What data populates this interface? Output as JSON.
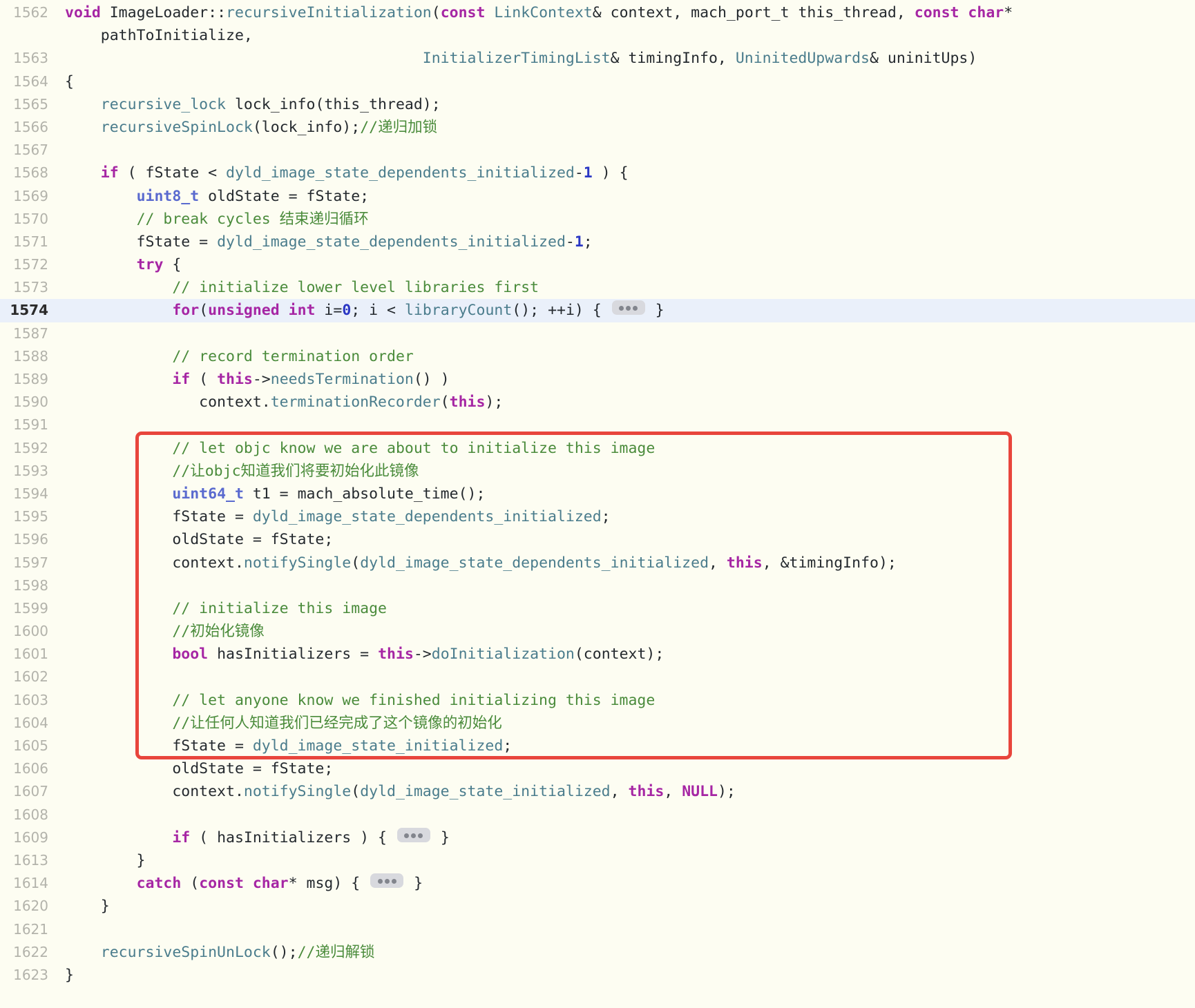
{
  "viewer": {
    "type": "source-code-viewer",
    "language": "C++",
    "background_color": "#fdfdf2",
    "highlight_color": "#eaf0fa",
    "annotation_color": "#e8453c",
    "gutter_color": "#b3b3ab"
  },
  "annotation": {
    "shape": "rectangle",
    "color": "#e8453c",
    "covers_lines": "1592-1607"
  },
  "collapsed_marker": {
    "label": "...",
    "tooltip": "expand collapsed code"
  },
  "lines": [
    {
      "number": "1562",
      "highlight": false,
      "tokens": [
        {
          "t": "void",
          "c": "kw"
        },
        {
          "t": " ",
          "c": "plain"
        },
        {
          "t": "ImageLoader",
          "c": "plain"
        },
        {
          "t": "::",
          "c": "plain"
        },
        {
          "t": "recursiveInitialization",
          "c": "fn"
        },
        {
          "t": "(",
          "c": "plain"
        },
        {
          "t": "const",
          "c": "kw"
        },
        {
          "t": " ",
          "c": "plain"
        },
        {
          "t": "LinkContext",
          "c": "cls"
        },
        {
          "t": "& context, mach_port_t this_thread, ",
          "c": "plain"
        },
        {
          "t": "const char",
          "c": "kw"
        },
        {
          "t": "*",
          "c": "plain"
        }
      ]
    },
    {
      "number": "",
      "highlight": false,
      "tokens": [
        {
          "t": "    pathToInitialize,",
          "c": "plain"
        }
      ]
    },
    {
      "number": "1563",
      "highlight": false,
      "tokens": [
        {
          "t": "                                        ",
          "c": "plain"
        },
        {
          "t": "InitializerTimingList",
          "c": "cls"
        },
        {
          "t": "& timingInfo, ",
          "c": "plain"
        },
        {
          "t": "UninitedUpwards",
          "c": "cls"
        },
        {
          "t": "& uninitUps)",
          "c": "plain"
        }
      ]
    },
    {
      "number": "1564",
      "highlight": false,
      "tokens": [
        {
          "t": "{",
          "c": "plain"
        }
      ]
    },
    {
      "number": "1565",
      "highlight": false,
      "tokens": [
        {
          "t": "    ",
          "c": "plain"
        },
        {
          "t": "recursive_lock",
          "c": "fn"
        },
        {
          "t": " lock_info(this_thread);",
          "c": "plain"
        }
      ]
    },
    {
      "number": "1566",
      "highlight": false,
      "tokens": [
        {
          "t": "    ",
          "c": "plain"
        },
        {
          "t": "recursiveSpinLock",
          "c": "fn"
        },
        {
          "t": "(lock_info);",
          "c": "plain"
        },
        {
          "t": "//递归加锁",
          "c": "cmt"
        }
      ]
    },
    {
      "number": "1567",
      "highlight": false,
      "tokens": [
        {
          "t": "",
          "c": "plain"
        }
      ]
    },
    {
      "number": "1568",
      "highlight": false,
      "tokens": [
        {
          "t": "    ",
          "c": "plain"
        },
        {
          "t": "if",
          "c": "kw"
        },
        {
          "t": " ( fState < ",
          "c": "plain"
        },
        {
          "t": "dyld_image_state_dependents_initialized",
          "c": "fn"
        },
        {
          "t": "-",
          "c": "plain"
        },
        {
          "t": "1",
          "c": "num"
        },
        {
          "t": " ) {",
          "c": "plain"
        }
      ]
    },
    {
      "number": "1569",
      "highlight": false,
      "tokens": [
        {
          "t": "        ",
          "c": "plain"
        },
        {
          "t": "uint8_t",
          "c": "type"
        },
        {
          "t": " oldState = fState;",
          "c": "plain"
        }
      ]
    },
    {
      "number": "1570",
      "highlight": false,
      "tokens": [
        {
          "t": "        ",
          "c": "plain"
        },
        {
          "t": "// break cycles 结束递归循环",
          "c": "cmt"
        }
      ]
    },
    {
      "number": "1571",
      "highlight": false,
      "tokens": [
        {
          "t": "        fState = ",
          "c": "plain"
        },
        {
          "t": "dyld_image_state_dependents_initialized",
          "c": "fn"
        },
        {
          "t": "-",
          "c": "plain"
        },
        {
          "t": "1",
          "c": "num"
        },
        {
          "t": ";",
          "c": "plain"
        }
      ]
    },
    {
      "number": "1572",
      "highlight": false,
      "tokens": [
        {
          "t": "        ",
          "c": "plain"
        },
        {
          "t": "try",
          "c": "kw"
        },
        {
          "t": " {",
          "c": "plain"
        }
      ]
    },
    {
      "number": "1573",
      "highlight": false,
      "tokens": [
        {
          "t": "            ",
          "c": "plain"
        },
        {
          "t": "// initialize lower level libraries first",
          "c": "cmt"
        }
      ]
    },
    {
      "number": "1574",
      "highlight": true,
      "tokens": [
        {
          "t": "            ",
          "c": "plain"
        },
        {
          "t": "for",
          "c": "kw"
        },
        {
          "t": "(",
          "c": "plain"
        },
        {
          "t": "unsigned int",
          "c": "kw"
        },
        {
          "t": " i=",
          "c": "plain"
        },
        {
          "t": "0",
          "c": "num"
        },
        {
          "t": "; i < ",
          "c": "plain"
        },
        {
          "t": "libraryCount",
          "c": "fn"
        },
        {
          "t": "(); ++i) { ",
          "c": "plain"
        },
        {
          "t": "PILL",
          "c": "pill"
        },
        {
          "t": " }",
          "c": "plain"
        }
      ]
    },
    {
      "number": "1587",
      "highlight": false,
      "tokens": [
        {
          "t": "",
          "c": "plain"
        }
      ]
    },
    {
      "number": "1588",
      "highlight": false,
      "tokens": [
        {
          "t": "            ",
          "c": "plain"
        },
        {
          "t": "// record termination order",
          "c": "cmt"
        }
      ]
    },
    {
      "number": "1589",
      "highlight": false,
      "tokens": [
        {
          "t": "            ",
          "c": "plain"
        },
        {
          "t": "if",
          "c": "kw"
        },
        {
          "t": " ( ",
          "c": "plain"
        },
        {
          "t": "this",
          "c": "kw"
        },
        {
          "t": "->",
          "c": "plain"
        },
        {
          "t": "needsTermination",
          "c": "fn"
        },
        {
          "t": "() )",
          "c": "plain"
        }
      ]
    },
    {
      "number": "1590",
      "highlight": false,
      "tokens": [
        {
          "t": "               context.",
          "c": "plain"
        },
        {
          "t": "terminationRecorder",
          "c": "fn"
        },
        {
          "t": "(",
          "c": "plain"
        },
        {
          "t": "this",
          "c": "kw"
        },
        {
          "t": ");",
          "c": "plain"
        }
      ]
    },
    {
      "number": "1591",
      "highlight": false,
      "tokens": [
        {
          "t": "",
          "c": "plain"
        }
      ]
    },
    {
      "number": "1592",
      "highlight": false,
      "tokens": [
        {
          "t": "            ",
          "c": "plain"
        },
        {
          "t": "// let objc know we are about to initialize this image",
          "c": "cmt"
        }
      ]
    },
    {
      "number": "1593",
      "highlight": false,
      "tokens": [
        {
          "t": "            ",
          "c": "plain"
        },
        {
          "t": "//让objc知道我们将要初始化此镜像",
          "c": "cmt"
        }
      ]
    },
    {
      "number": "1594",
      "highlight": false,
      "tokens": [
        {
          "t": "            ",
          "c": "plain"
        },
        {
          "t": "uint64_t",
          "c": "type"
        },
        {
          "t": " t1 = mach_absolute_time();",
          "c": "plain"
        }
      ]
    },
    {
      "number": "1595",
      "highlight": false,
      "tokens": [
        {
          "t": "            fState = ",
          "c": "plain"
        },
        {
          "t": "dyld_image_state_dependents_initialized",
          "c": "fn"
        },
        {
          "t": ";",
          "c": "plain"
        }
      ]
    },
    {
      "number": "1596",
      "highlight": false,
      "tokens": [
        {
          "t": "            oldState = fState;",
          "c": "plain"
        }
      ]
    },
    {
      "number": "1597",
      "highlight": false,
      "tokens": [
        {
          "t": "            context.",
          "c": "plain"
        },
        {
          "t": "notifySingle",
          "c": "fn"
        },
        {
          "t": "(",
          "c": "plain"
        },
        {
          "t": "dyld_image_state_dependents_initialized",
          "c": "fn"
        },
        {
          "t": ", ",
          "c": "plain"
        },
        {
          "t": "this",
          "c": "kw"
        },
        {
          "t": ", &timingInfo);",
          "c": "plain"
        }
      ]
    },
    {
      "number": "1598",
      "highlight": false,
      "tokens": [
        {
          "t": "",
          "c": "plain"
        }
      ]
    },
    {
      "number": "1599",
      "highlight": false,
      "tokens": [
        {
          "t": "            ",
          "c": "plain"
        },
        {
          "t": "// initialize this image",
          "c": "cmt"
        }
      ]
    },
    {
      "number": "1600",
      "highlight": false,
      "tokens": [
        {
          "t": "            ",
          "c": "plain"
        },
        {
          "t": "//初始化镜像",
          "c": "cmt"
        }
      ]
    },
    {
      "number": "1601",
      "highlight": false,
      "tokens": [
        {
          "t": "            ",
          "c": "plain"
        },
        {
          "t": "bool",
          "c": "kw"
        },
        {
          "t": " hasInitializers = ",
          "c": "plain"
        },
        {
          "t": "this",
          "c": "kw"
        },
        {
          "t": "->",
          "c": "plain"
        },
        {
          "t": "doInitialization",
          "c": "fn"
        },
        {
          "t": "(context);",
          "c": "plain"
        }
      ]
    },
    {
      "number": "1602",
      "highlight": false,
      "tokens": [
        {
          "t": "",
          "c": "plain"
        }
      ]
    },
    {
      "number": "1603",
      "highlight": false,
      "tokens": [
        {
          "t": "            ",
          "c": "plain"
        },
        {
          "t": "// let anyone know we finished initializing this image",
          "c": "cmt"
        }
      ]
    },
    {
      "number": "1604",
      "highlight": false,
      "tokens": [
        {
          "t": "            ",
          "c": "plain"
        },
        {
          "t": "//让任何人知道我们已经完成了这个镜像的初始化",
          "c": "cmt"
        }
      ]
    },
    {
      "number": "1605",
      "highlight": false,
      "tokens": [
        {
          "t": "            fState = ",
          "c": "plain"
        },
        {
          "t": "dyld_image_state_initialized",
          "c": "fn"
        },
        {
          "t": ";",
          "c": "plain"
        }
      ]
    },
    {
      "number": "1606",
      "highlight": false,
      "tokens": [
        {
          "t": "            oldState = fState;",
          "c": "plain"
        }
      ]
    },
    {
      "number": "1607",
      "highlight": false,
      "tokens": [
        {
          "t": "            context.",
          "c": "plain"
        },
        {
          "t": "notifySingle",
          "c": "fn"
        },
        {
          "t": "(",
          "c": "plain"
        },
        {
          "t": "dyld_image_state_initialized",
          "c": "fn"
        },
        {
          "t": ", ",
          "c": "plain"
        },
        {
          "t": "this",
          "c": "kw"
        },
        {
          "t": ", ",
          "c": "plain"
        },
        {
          "t": "NULL",
          "c": "kw"
        },
        {
          "t": ");",
          "c": "plain"
        }
      ]
    },
    {
      "number": "1608",
      "highlight": false,
      "tokens": [
        {
          "t": "",
          "c": "plain"
        }
      ]
    },
    {
      "number": "1609",
      "highlight": false,
      "tokens": [
        {
          "t": "            ",
          "c": "plain"
        },
        {
          "t": "if",
          "c": "kw"
        },
        {
          "t": " ( hasInitializers ) { ",
          "c": "plain"
        },
        {
          "t": "PILL",
          "c": "pill"
        },
        {
          "t": " }",
          "c": "plain"
        }
      ]
    },
    {
      "number": "1613",
      "highlight": false,
      "tokens": [
        {
          "t": "        }",
          "c": "plain"
        }
      ]
    },
    {
      "number": "1614",
      "highlight": false,
      "tokens": [
        {
          "t": "        ",
          "c": "plain"
        },
        {
          "t": "catch",
          "c": "kw"
        },
        {
          "t": " (",
          "c": "plain"
        },
        {
          "t": "const char",
          "c": "kw"
        },
        {
          "t": "* msg) { ",
          "c": "plain"
        },
        {
          "t": "PILL",
          "c": "pill"
        },
        {
          "t": " }",
          "c": "plain"
        }
      ]
    },
    {
      "number": "1620",
      "highlight": false,
      "tokens": [
        {
          "t": "    }",
          "c": "plain"
        }
      ]
    },
    {
      "number": "1621",
      "highlight": false,
      "tokens": [
        {
          "t": "",
          "c": "plain"
        }
      ]
    },
    {
      "number": "1622",
      "highlight": false,
      "tokens": [
        {
          "t": "    ",
          "c": "plain"
        },
        {
          "t": "recursiveSpinUnLock",
          "c": "fn"
        },
        {
          "t": "();",
          "c": "plain"
        },
        {
          "t": "//递归解锁",
          "c": "cmt"
        }
      ]
    },
    {
      "number": "1623",
      "highlight": false,
      "tokens": [
        {
          "t": "}",
          "c": "plain"
        }
      ]
    }
  ]
}
